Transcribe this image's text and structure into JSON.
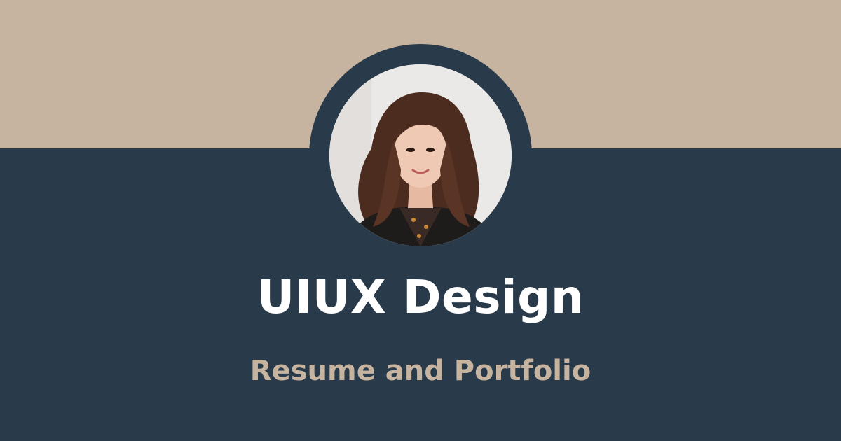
{
  "hero": {
    "title": "UIUX Design",
    "subtitle": "Resume and Portfolio"
  },
  "avatar": {
    "icon": "profile-photo"
  },
  "colors": {
    "top_band": "#c6b4a0",
    "background": "#293a4b",
    "title": "#ffffff",
    "subtitle": "#c6b4a0"
  }
}
